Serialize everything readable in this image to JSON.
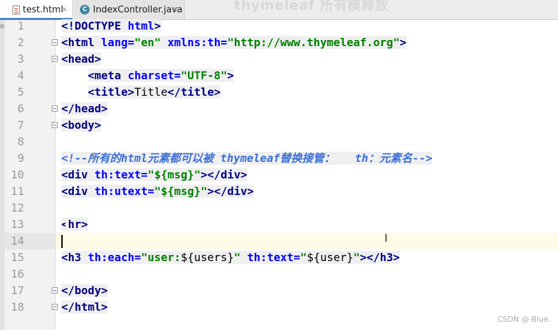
{
  "watermark": "thymeleaf 所有模释放",
  "tabs": [
    {
      "label": "test.html",
      "active": true,
      "close": "×"
    },
    {
      "label": "IndexController.java",
      "active": false,
      "close": "×"
    }
  ],
  "left_strip_text": "ot",
  "editor": {
    "current_line": 14,
    "lines": [
      {
        "n": "1"
      },
      {
        "n": "2"
      },
      {
        "n": "3"
      },
      {
        "n": "4"
      },
      {
        "n": "5"
      },
      {
        "n": "6"
      },
      {
        "n": "7"
      },
      {
        "n": "8"
      },
      {
        "n": "9"
      },
      {
        "n": "10"
      },
      {
        "n": "11"
      },
      {
        "n": "12"
      },
      {
        "n": "13"
      },
      {
        "n": "14"
      },
      {
        "n": "15"
      },
      {
        "n": "16"
      },
      {
        "n": "17"
      },
      {
        "n": "18"
      }
    ],
    "code": {
      "l1": {
        "tag": "<!DOCTYPE ",
        "attr": "html",
        "close": ">"
      },
      "l2": {
        "open": "<html ",
        "a1": "lang=",
        "v1": "\"en\"",
        "a2": " xmlns:th=",
        "v2": "\"http://www.thymeleaf.org\"",
        "close": ">"
      },
      "l3": {
        "text": "<head>"
      },
      "l4": {
        "open": "<meta ",
        "a1": "charset=",
        "v1": "\"UTF-8\"",
        "close": ">"
      },
      "l5": {
        "open": "<title>",
        "text": "Title",
        "close": "</title>"
      },
      "l6": {
        "text": "</head>"
      },
      "l7": {
        "text": "<body>"
      },
      "l9": {
        "text": "<!--所有的html元素都可以被 thymeleaf替换接管：   th：元素名-->"
      },
      "l10": {
        "open": "<div ",
        "a1": "th:text=",
        "v1": "\"${msg}\"",
        "close": "></div>"
      },
      "l11": {
        "open": "<div ",
        "a1": "th:utext=",
        "v1": "\"${msg}\"",
        "close": "></div>"
      },
      "l13": {
        "open": "<",
        "after": "hr>"
      },
      "l15": {
        "open": "<h3 ",
        "a1": "th:each=",
        "v1a": "\"user:",
        "v1b": "${users}",
        "v1c": "\"",
        "a2": " th:text=",
        "v2a": "\"",
        "v2b": "${user}",
        "v2c": "\"",
        "close": "></h3>"
      },
      "l17": {
        "text": "</body>"
      },
      "l18": {
        "text": "</html>"
      }
    }
  },
  "footer_watermark": "CSDN @-Blue.",
  "colors": {
    "tag": "#000080",
    "attribute": "#0000ff",
    "string": "#008000",
    "comment": "#3c6fd4",
    "current_line": "#fefbe6"
  }
}
